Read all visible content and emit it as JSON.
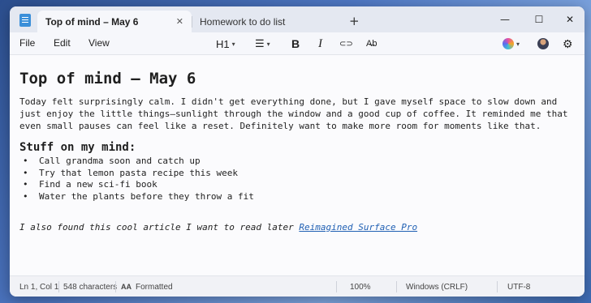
{
  "tabs": [
    {
      "label": "Top of mind – May 6",
      "active": true
    },
    {
      "label": "Homework to do list",
      "active": false
    }
  ],
  "icons": {
    "app": "notepad-icon",
    "close": "close-icon",
    "new_tab": "plus-icon",
    "minimize": "minimize-icon",
    "maximize": "maximize-icon",
    "window_close": "close-icon",
    "list": "bulleted-list-icon",
    "bold": "bold-icon",
    "italic": "italic-icon",
    "link": "link-icon",
    "clear_format": "clear-formatting-icon",
    "copilot": "copilot-icon",
    "avatar": "account-avatar-icon",
    "settings": "gear-icon",
    "formatted": "text-format-icon"
  },
  "glyphs": {
    "close": "✕",
    "new_tab": "+",
    "minimize": "—",
    "maximize": "☐",
    "window_close": "✕",
    "list": "☰",
    "bold": "B",
    "italic": "I",
    "link": "⊂⊃",
    "clear_format": "A̶b",
    "settings": "⚙",
    "chevron": "▾"
  },
  "menu": {
    "file": "File",
    "edit": "Edit",
    "view": "View"
  },
  "toolbar": {
    "heading": "H1"
  },
  "document": {
    "title": "Top of mind – May 6",
    "paragraph": "Today felt surprisingly calm. I didn't get everything done, but I gave myself space to slow down and just enjoy the little things—sunlight through the window and a good cup of coffee. It reminded me that even small pauses can feel like a reset. Definitely want to make more room for moments like that.",
    "subheading": "Stuff on my mind:",
    "list": [
      "Call grandma soon and catch up",
      "Try that lemon pasta recipe this week",
      "Find a new sci-fi book",
      "Water the plants before they throw a fit"
    ],
    "closing_text": "I also found this cool article I want to read later ",
    "link_text": "Reimagined Surface Pro"
  },
  "status": {
    "position": "Ln 1, Col 1",
    "characters": "548 characters",
    "format_icon": "AA",
    "format": "Formatted",
    "zoom": "100%",
    "line_ending": "Windows (CRLF)",
    "encoding": "UTF-8"
  },
  "colors": {
    "accent": "#3b8fd9",
    "link": "#1f5fb3",
    "titlebar": "#e4e8f1"
  }
}
